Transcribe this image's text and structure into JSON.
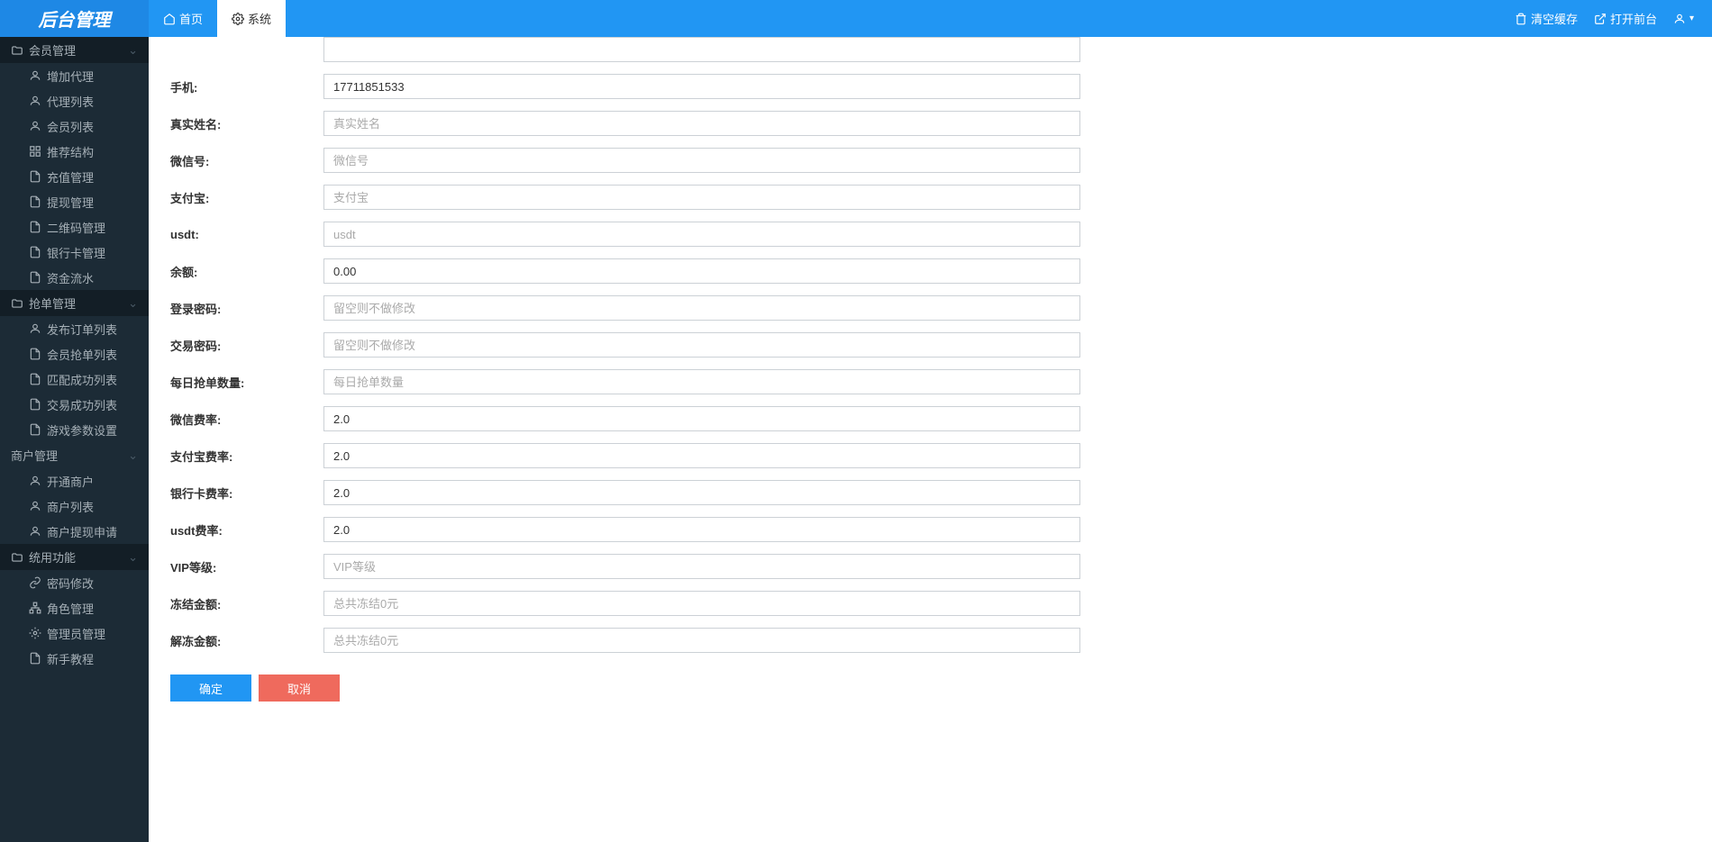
{
  "header": {
    "logo": "后台管理",
    "tabs": [
      {
        "label": "首页"
      },
      {
        "label": "系统"
      }
    ],
    "right": {
      "clear_cache": "清空缓存",
      "open_front": "打开前台"
    }
  },
  "sidebar": {
    "groups": [
      {
        "label": "会员管理",
        "items": [
          {
            "label": "增加代理",
            "icon": "user"
          },
          {
            "label": "代理列表",
            "icon": "user"
          },
          {
            "label": "会员列表",
            "icon": "user"
          },
          {
            "label": "推荐结构",
            "icon": "grid"
          },
          {
            "label": "充值管理",
            "icon": "doc"
          },
          {
            "label": "提现管理",
            "icon": "doc"
          },
          {
            "label": "二维码管理",
            "icon": "doc"
          },
          {
            "label": "银行卡管理",
            "icon": "doc"
          },
          {
            "label": "资金流水",
            "icon": "doc"
          }
        ]
      },
      {
        "label": "抢单管理",
        "items": [
          {
            "label": "发布订单列表",
            "icon": "user"
          },
          {
            "label": "会员抢单列表",
            "icon": "doc"
          },
          {
            "label": "匹配成功列表",
            "icon": "doc"
          },
          {
            "label": "交易成功列表",
            "icon": "doc"
          },
          {
            "label": "游戏参数设置",
            "icon": "doc"
          }
        ]
      },
      {
        "label": "商户管理",
        "plain": true,
        "items": [
          {
            "label": "开通商户",
            "icon": "user"
          },
          {
            "label": "商户列表",
            "icon": "user"
          },
          {
            "label": "商户提现申请",
            "icon": "user"
          }
        ]
      },
      {
        "label": "统用功能",
        "items": [
          {
            "label": "密码修改",
            "icon": "link"
          },
          {
            "label": "角色管理",
            "icon": "sitemap"
          },
          {
            "label": "管理员管理",
            "icon": "gear"
          },
          {
            "label": "新手教程",
            "icon": "doc"
          }
        ]
      }
    ]
  },
  "form": {
    "fields": [
      {
        "label": "",
        "value": "",
        "placeholder": "",
        "name": "top-empty"
      },
      {
        "label": "手机:",
        "value": "17711851533",
        "placeholder": "",
        "name": "phone"
      },
      {
        "label": "真实姓名:",
        "value": "",
        "placeholder": "真实姓名",
        "name": "real-name"
      },
      {
        "label": "微信号:",
        "value": "",
        "placeholder": "微信号",
        "name": "wechat"
      },
      {
        "label": "支付宝:",
        "value": "",
        "placeholder": "支付宝",
        "name": "alipay"
      },
      {
        "label": "usdt:",
        "value": "",
        "placeholder": "usdt",
        "name": "usdt"
      },
      {
        "label": "余额:",
        "value": "0.00",
        "placeholder": "",
        "name": "balance"
      },
      {
        "label": "登录密码:",
        "value": "",
        "placeholder": "留空则不做修改",
        "name": "login-password"
      },
      {
        "label": "交易密码:",
        "value": "",
        "placeholder": "留空则不做修改",
        "name": "trade-password"
      },
      {
        "label": "每日抢单数量:",
        "value": "",
        "placeholder": "每日抢单数量",
        "name": "daily-orders"
      },
      {
        "label": "微信费率:",
        "value": "2.0",
        "placeholder": "",
        "name": "wechat-rate"
      },
      {
        "label": "支付宝费率:",
        "value": "2.0",
        "placeholder": "",
        "name": "alipay-rate"
      },
      {
        "label": "银行卡费率:",
        "value": "2.0",
        "placeholder": "",
        "name": "bankcard-rate"
      },
      {
        "label": "usdt费率:",
        "value": "2.0",
        "placeholder": "",
        "name": "usdt-rate"
      },
      {
        "label": "VIP等级:",
        "value": "",
        "placeholder": "VIP等级",
        "name": "vip-level"
      },
      {
        "label": "冻结金额:",
        "value": "",
        "placeholder": "总共冻结0元",
        "name": "freeze-amount"
      },
      {
        "label": "解冻金额:",
        "value": "",
        "placeholder": "总共冻结0元",
        "name": "unfreeze-amount"
      }
    ],
    "actions": {
      "confirm": "确定",
      "cancel": "取消"
    }
  }
}
